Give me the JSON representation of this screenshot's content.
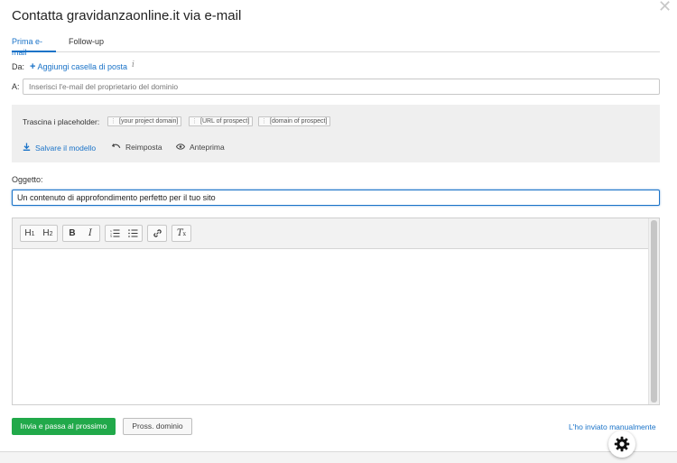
{
  "dialog": {
    "title": "Contatta gravidanzaonline.it via e-mail",
    "close_icon": "close-icon"
  },
  "tabs": [
    {
      "label": "Prima e-mail",
      "active": true
    },
    {
      "label": "Follow-up",
      "active": false
    }
  ],
  "from": {
    "label": "Da:",
    "add_mailbox_label": "Aggiungi casella di posta",
    "info_icon": "info-icon"
  },
  "to": {
    "label": "A:",
    "placeholder": "Inserisci l'e-mail del proprietario del dominio",
    "value": ""
  },
  "placeholders": {
    "label": "Trascina i placeholder:",
    "chips": [
      "[your project domain]",
      "[URL of prospect]",
      "[domain of prospect]"
    ]
  },
  "template_actions": {
    "save_label": "Salvare il modello",
    "reset_label": "Reimposta",
    "preview_label": "Anteprima"
  },
  "subject": {
    "label": "Oggetto:",
    "value": "Un contenuto di approfondimento perfetto per il tuo sito"
  },
  "editor": {
    "toolbar": [
      "H1",
      "H2",
      "B",
      "I",
      "ordered-list-icon",
      "unordered-list-icon",
      "link-icon",
      "clear-format-icon"
    ],
    "body": ""
  },
  "footer": {
    "send_next_label": "Invia e passa al prossimo",
    "next_domain_label": "Pross. dominio",
    "manual_sent_label": "L'ho inviato manualmente"
  },
  "colors": {
    "accent": "#1a73c8",
    "primary_button": "#21a94a",
    "panel_bg": "#efefef"
  }
}
